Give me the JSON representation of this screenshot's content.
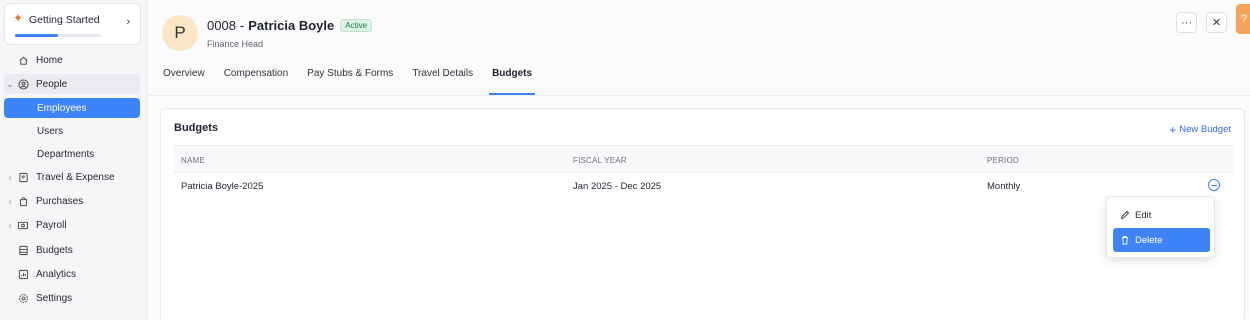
{
  "sidebar": {
    "getting_started": {
      "label": "Getting Started",
      "progress": 0.5
    },
    "items": [
      {
        "label": "Home",
        "icon": "home-icon"
      },
      {
        "label": "People",
        "icon": "people-icon",
        "expanded": true
      },
      {
        "label": "Employees"
      },
      {
        "label": "Users"
      },
      {
        "label": "Departments"
      },
      {
        "label": "Travel & Expense",
        "icon": "travel-expense-icon"
      },
      {
        "label": "Purchases",
        "icon": "purchases-icon"
      },
      {
        "label": "Payroll",
        "icon": "payroll-icon"
      },
      {
        "label": "Budgets",
        "icon": "budgets-icon"
      },
      {
        "label": "Analytics",
        "icon": "analytics-icon"
      },
      {
        "label": "Settings",
        "icon": "settings-icon"
      }
    ]
  },
  "header": {
    "avatar_initial": "P",
    "employee_number": "0008",
    "separator": "-",
    "employee_name": "Patricia Boyle",
    "status": "Active",
    "designation": "Finance Head",
    "more_label": "···",
    "close_label": "✕",
    "help_label": "?"
  },
  "tabs": [
    "Overview",
    "Compensation",
    "Pay Stubs & Forms",
    "Travel Details",
    "Budgets"
  ],
  "active_tab": "Budgets",
  "budgets_card": {
    "title": "Budgets",
    "new_button": "New Budget",
    "columns": [
      "NAME",
      "FISCAL YEAR",
      "PERIOD"
    ],
    "rows": [
      {
        "name": "Patricia Boyle-2025",
        "fiscal_year": "Jan 2025 - Dec 2025",
        "period": "Monthly"
      }
    ]
  },
  "row_menu": {
    "items": [
      "Edit",
      "Delete"
    ],
    "highlighted": "Delete"
  },
  "colors": {
    "accent": "#3f83f8",
    "active_badge_bg": "#dcf2e5",
    "avatar_bg": "#fde6c8",
    "help_bg": "#f5a35a",
    "star": "#f4711b"
  }
}
